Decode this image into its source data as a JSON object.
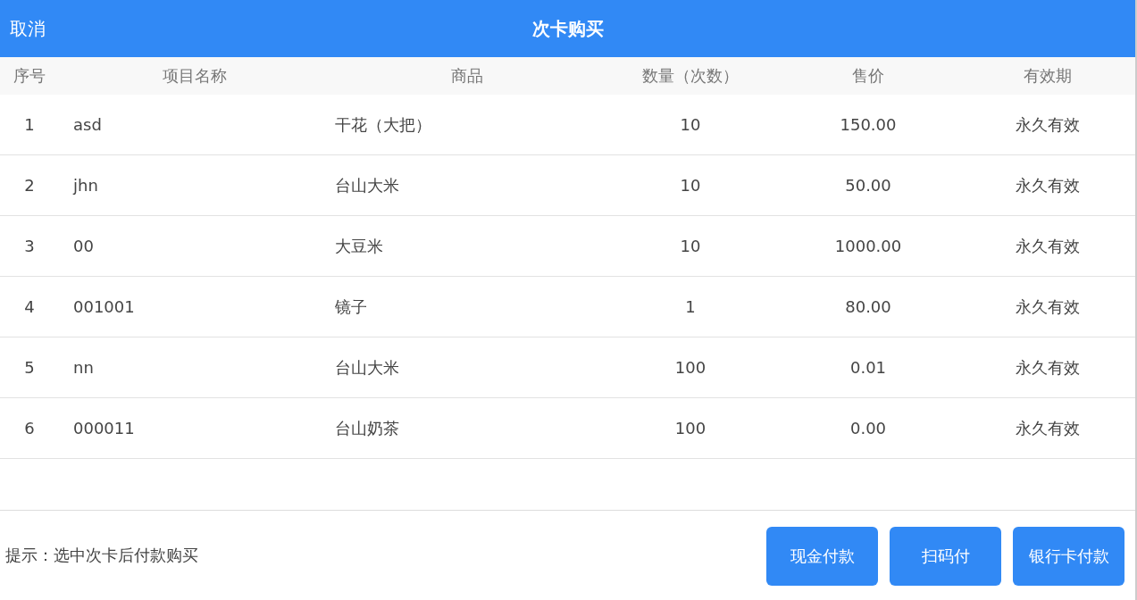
{
  "header": {
    "cancel": "取消",
    "title": "次卡购买"
  },
  "table": {
    "columns": [
      "序号",
      "项目名称",
      "商品",
      "数量（次数）",
      "售价",
      "有效期"
    ],
    "rows": [
      {
        "index": "1",
        "name": "asd",
        "product": "干花（大把）",
        "quantity": "10",
        "price": "150.00",
        "validity": "永久有效"
      },
      {
        "index": "2",
        "name": "jhn",
        "product": "台山大米",
        "quantity": "10",
        "price": "50.00",
        "validity": "永久有效"
      },
      {
        "index": "3",
        "name": "00",
        "product": "大豆米",
        "quantity": "10",
        "price": "1000.00",
        "validity": "永久有效"
      },
      {
        "index": "4",
        "name": "001001",
        "product": "镜子",
        "quantity": "1",
        "price": "80.00",
        "validity": "永久有效"
      },
      {
        "index": "5",
        "name": "nn",
        "product": "台山大米",
        "quantity": "100",
        "price": "0.01",
        "validity": "永久有效"
      },
      {
        "index": "6",
        "name": "000011",
        "product": "台山奶茶",
        "quantity": "100",
        "price": "0.00",
        "validity": "永久有效"
      }
    ]
  },
  "footer": {
    "hint": "提示：选中次卡后付款购买",
    "buttons": [
      "现金付款",
      "扫码付",
      "银行卡付款"
    ]
  }
}
